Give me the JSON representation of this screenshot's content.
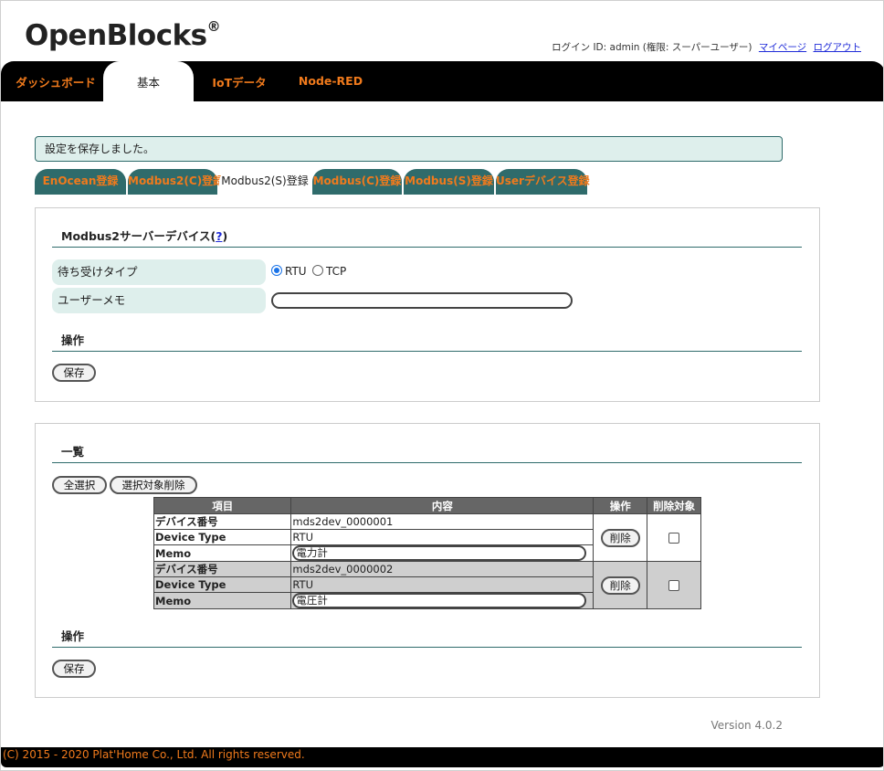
{
  "header": {
    "logo": "OpenBlocks",
    "logo_mark": "®",
    "login_info": "ログイン ID: admin (権限: スーパーユーザー)",
    "mypage_link": "マイページ",
    "logout_link": "ログアウト"
  },
  "nav": {
    "tabs": [
      {
        "label": "ダッシュボード"
      },
      {
        "label": "基本"
      },
      {
        "label": "IoTデータ"
      },
      {
        "label": "Node-RED"
      }
    ],
    "active": "基本"
  },
  "message": "設定を保存しました。",
  "subtabs": {
    "items": [
      {
        "label": "EnOcean登録"
      },
      {
        "label": "Modbus2(C)登録"
      },
      {
        "label": "Modbus2(S)登録"
      },
      {
        "label": "Modbus(C)登録"
      },
      {
        "label": "Modbus(S)登録"
      },
      {
        "label": "Userデバイス登録"
      }
    ],
    "active": "Modbus2(S)登録"
  },
  "form_panel": {
    "title": "Modbus2サーバーデバイス(",
    "help": "?",
    "title_close": ")",
    "wait_type_label": "待ち受けタイプ",
    "radio_rtu": "RTU",
    "radio_tcp": "TCP",
    "selected": "RTU",
    "memo_label": "ユーザーメモ",
    "memo_value": "",
    "ops_title": "操作",
    "save_button": "保存"
  },
  "list_panel": {
    "title": "一覧",
    "select_all_button": "全選択",
    "delete_selected_button": "選択対象削除",
    "columns": [
      "項目",
      "内容",
      "操作",
      "削除対象"
    ],
    "field_labels": {
      "device_no": "デバイス番号",
      "device_type": "Device Type",
      "memo": "Memo"
    },
    "delete_button": "削除",
    "rows": [
      {
        "device_no": "mds2dev_0000001",
        "device_type": "RTU",
        "memo": "電力計",
        "checked": false
      },
      {
        "device_no": "mds2dev_0000002",
        "device_type": "RTU",
        "memo": "電圧計",
        "checked": false
      }
    ],
    "ops_title": "操作",
    "save_button": "保存"
  },
  "version": "Version 4.0.2",
  "footer": "(C) 2015 - 2020 Plat'Home Co., Ltd. All rights reserved.",
  "colors": {
    "accent": "#f07a1c",
    "teal": "#2f6b6b",
    "light_teal": "#deefec"
  }
}
